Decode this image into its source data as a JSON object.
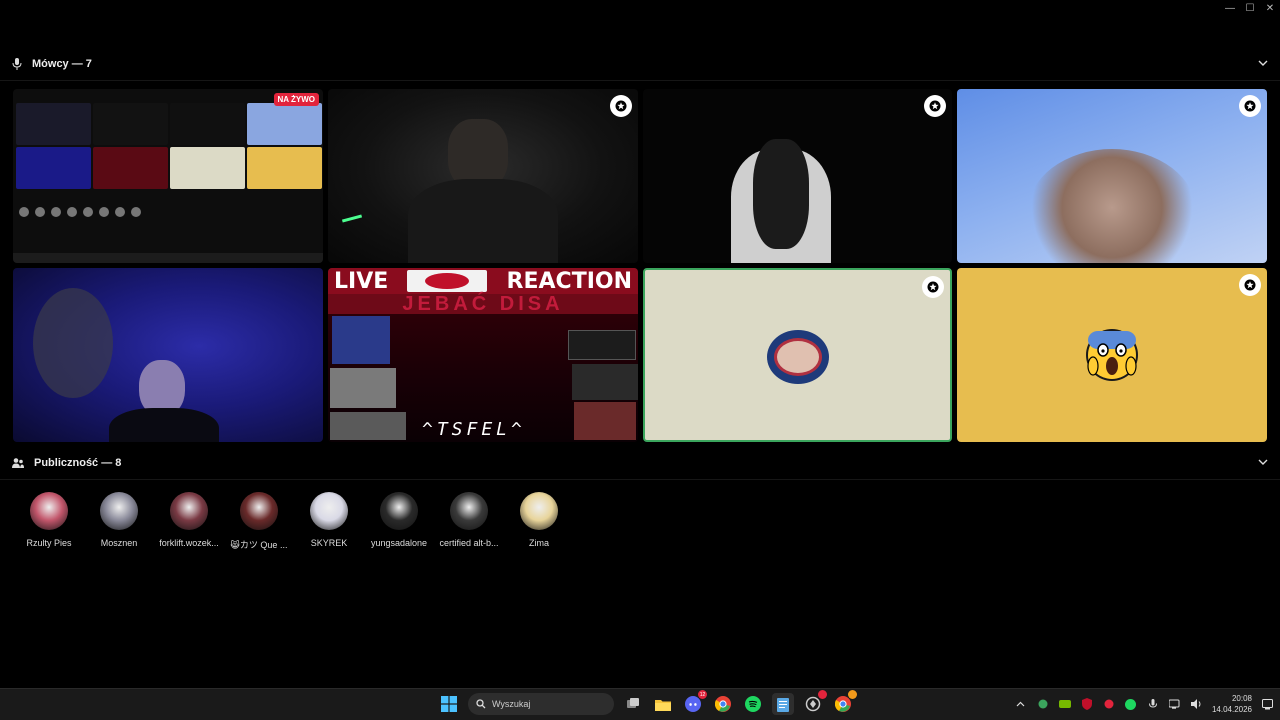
{
  "speakers": {
    "title": "Mówcy — 7",
    "tiles": [
      {
        "kind": "screenshare",
        "badge": "NA ŻYWO"
      },
      {
        "kind": "camera"
      },
      {
        "kind": "camera"
      },
      {
        "kind": "camera"
      },
      {
        "kind": "camera"
      },
      {
        "kind": "stream",
        "top_left": "LIVE",
        "top_right": "REACTION",
        "subtitle": "JEBAĆ DISA",
        "caption": "^TSFEL^"
      },
      {
        "kind": "avatar",
        "speaking": true
      },
      {
        "kind": "avatar",
        "emoji": "😱"
      }
    ]
  },
  "audience": {
    "title": "Publiczność — 8",
    "members": [
      {
        "name": "Rzulty Pies",
        "color": "#c2566b"
      },
      {
        "name": "Mosznen",
        "color": "#8a8a9a"
      },
      {
        "name": "forklift.wozek...",
        "color": "#7a3a44"
      },
      {
        "name": "😸カツ Que ...",
        "color": "#6a2a2a"
      },
      {
        "name": "SKYREK",
        "color": "#d9d9e6"
      },
      {
        "name": "yungsadalone",
        "color": "#2a2a2a"
      },
      {
        "name": "certified alt-b...",
        "color": "#3a3a3a"
      },
      {
        "name": "Zima",
        "color": "#e8d49a"
      }
    ]
  },
  "taskbar": {
    "search_placeholder": "Wyszukaj",
    "discord_badge": "12",
    "time": "20:08",
    "date": "14.04.2026"
  },
  "colors": {
    "speaking_border": "#3ba55d",
    "yellow_tile": "#e7bd4f",
    "beige_tile": "#dcdac6",
    "live_red": "#e2243c"
  }
}
